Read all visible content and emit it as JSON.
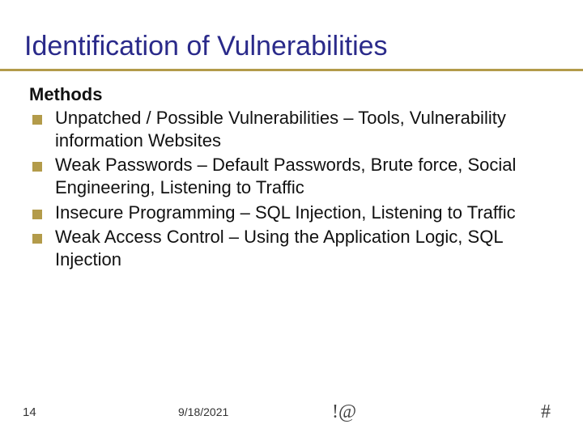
{
  "title": "Identification of Vulnerabilities",
  "section_label": "Methods",
  "bullets": [
    "Unpatched / Possible Vulnerabilities – Tools, Vulnerability information Websites",
    "Weak Passwords – Default Passwords, Brute force, Social Engineering, Listening to Traffic",
    "Insecure Programming – SQL Injection, Listening to Traffic",
    "Weak Access Control – Using the Application Logic, SQL Injection"
  ],
  "footer": {
    "page_number": "14",
    "date": "9/18/2021",
    "symbol_left": "!@",
    "symbol_right": "#"
  }
}
